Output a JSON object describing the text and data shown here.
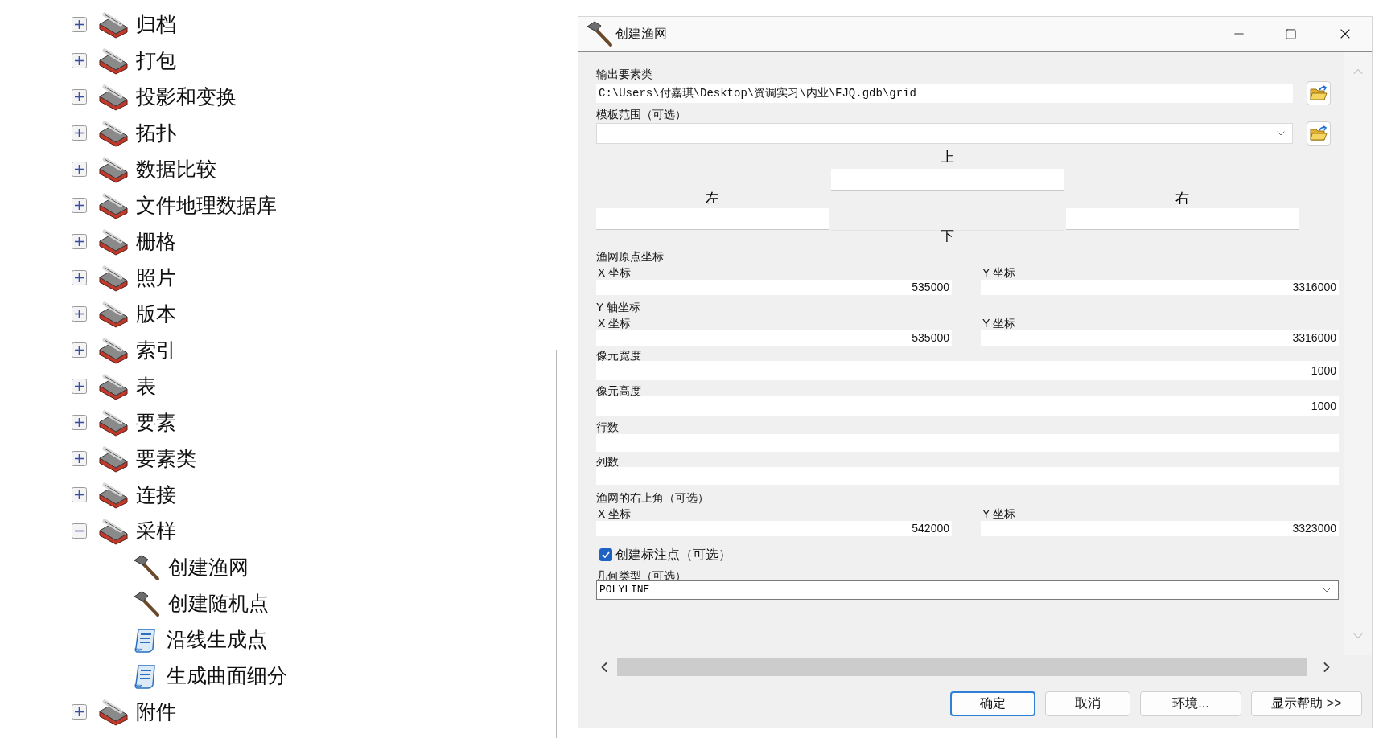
{
  "tree": [
    {
      "label": "归档",
      "kind": "toolset",
      "expanded": false
    },
    {
      "label": "打包",
      "kind": "toolset",
      "expanded": false
    },
    {
      "label": "投影和变换",
      "kind": "toolset",
      "expanded": false
    },
    {
      "label": "拓扑",
      "kind": "toolset",
      "expanded": false
    },
    {
      "label": "数据比较",
      "kind": "toolset",
      "expanded": false
    },
    {
      "label": "文件地理数据库",
      "kind": "toolset",
      "expanded": false
    },
    {
      "label": "栅格",
      "kind": "toolset",
      "expanded": false
    },
    {
      "label": "照片",
      "kind": "toolset",
      "expanded": false
    },
    {
      "label": "版本",
      "kind": "toolset",
      "expanded": false
    },
    {
      "label": "索引",
      "kind": "toolset",
      "expanded": false
    },
    {
      "label": "表",
      "kind": "toolset",
      "expanded": false
    },
    {
      "label": "要素",
      "kind": "toolset",
      "expanded": false
    },
    {
      "label": "要素类",
      "kind": "toolset",
      "expanded": false
    },
    {
      "label": "连接",
      "kind": "toolset",
      "expanded": false
    },
    {
      "label": "采样",
      "kind": "toolset",
      "expanded": true,
      "children": [
        {
          "label": "创建渔网",
          "kind": "tool"
        },
        {
          "label": "创建随机点",
          "kind": "tool"
        },
        {
          "label": "沿线生成点",
          "kind": "script"
        },
        {
          "label": "生成曲面细分",
          "kind": "script"
        }
      ]
    },
    {
      "label": "附件",
      "kind": "toolset",
      "expanded": false
    }
  ],
  "dialog": {
    "title": "创建渔网",
    "output_feature_class": {
      "label": "输出要素类",
      "value": "C:\\Users\\付嘉琪\\Desktop\\资调实习\\内业\\FJQ.gdb\\grid"
    },
    "template_extent": {
      "label": "模板范围（可选）",
      "top_label": "上",
      "left_label": "左",
      "right_label": "右",
      "bottom_label": "下"
    },
    "origin": {
      "label": "渔网原点坐标",
      "x_label": "X 坐标",
      "x_value": "535000",
      "y_label": "Y 坐标",
      "y_value": "3316000"
    },
    "y_axis": {
      "label": "Y 轴坐标",
      "x_label": "X 坐标",
      "x_value": "535000",
      "y_label": "Y 坐标",
      "y_value": "3316000"
    },
    "cell_width": {
      "label": "像元宽度",
      "value": "1000"
    },
    "cell_height": {
      "label": "像元高度",
      "value": "1000"
    },
    "rows": {
      "label": "行数"
    },
    "columns": {
      "label": "列数"
    },
    "opposite_corner": {
      "label": "渔网的右上角（可选）",
      "x_label": "X 坐标",
      "x_value": "542000",
      "y_label": "Y 坐标",
      "y_value": "3323000"
    },
    "create_labels": {
      "label": "创建标注点（可选）",
      "checked": true
    },
    "geometry_type": {
      "label": "几何类型（可选）",
      "value": "POLYLINE"
    },
    "buttons": [
      {
        "label": "确定",
        "default": true
      },
      {
        "label": "取消",
        "default": false
      },
      {
        "label": "环境...",
        "default": false
      },
      {
        "label": "显示帮助 >>",
        "default": false
      }
    ]
  }
}
